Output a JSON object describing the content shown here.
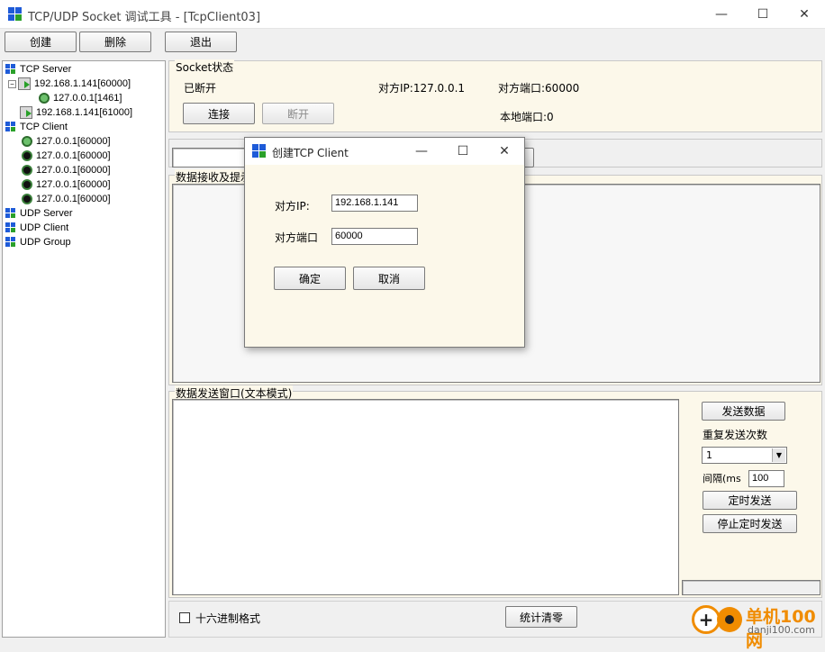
{
  "window": {
    "title": "TCP/UDP Socket 调试工具 - [TcpClient03]",
    "minimize": "—",
    "maximize": "☐",
    "close": "✕"
  },
  "toolbar": {
    "create": "创建",
    "delete": "删除",
    "exit": "退出"
  },
  "tree": {
    "tcp_server": "TCP Server",
    "server_1": "192.168.1.141[60000]",
    "server_1_child": "127.0.0.1[1461]",
    "server_2": "192.168.1.141[61000]",
    "tcp_client": "TCP Client",
    "clients": [
      "127.0.0.1[60000]",
      "127.0.0.1[60000]",
      "127.0.0.1[60000]",
      "127.0.0.1[60000]",
      "127.0.0.1[60000]"
    ],
    "udp_server": "UDP Server",
    "udp_client": "UDP Client",
    "udp_group": "UDP Group"
  },
  "socket_status": {
    "group_title": "Socket状态",
    "state": "已断开",
    "remote_ip": "对方IP:127.0.0.1",
    "remote_port": "对方端口:60000",
    "connect": "连接",
    "disconnect": "断开",
    "local_port": "本地端口:0"
  },
  "receive": {
    "group_title": "数据接收及提示"
  },
  "send": {
    "group_title": "数据发送窗口(文本模式)",
    "send_button": "发送数据",
    "repeat_label": "重复发送次数",
    "repeat_value": "1",
    "interval_label": "间隔(ms",
    "interval_value": "100",
    "timed_send": "定时发送",
    "stop_timed_send": "停止定时发送"
  },
  "footer": {
    "hex_format": "十六进制格式",
    "reset_stats": "统计清零"
  },
  "dialog": {
    "title": "创建TCP Client",
    "ip_label": "对方IP:",
    "ip_value": "192.168.1.141",
    "port_label": "对方端口",
    "port_value": "60000",
    "ok": "确定",
    "cancel": "取消"
  },
  "watermark": {
    "brand": "单机100网",
    "url": "danji100.com"
  }
}
